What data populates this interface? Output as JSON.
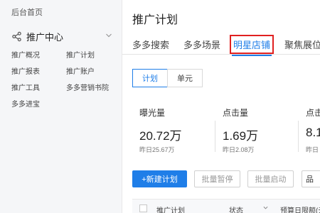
{
  "sidebar": {
    "home": "后台首页",
    "section_title": "推广中心",
    "items": [
      "推广概况",
      "推广计划",
      "推广报表",
      "推广账户",
      "推广工具",
      "多多营销书院",
      "多多进宝"
    ]
  },
  "main": {
    "title": "推广计划",
    "tabs": [
      "多多搜索",
      "多多场景",
      "明星店铺",
      "聚焦展位"
    ],
    "active_tab": "明星店铺",
    "subtabs": [
      "计划",
      "单元"
    ],
    "stats": [
      {
        "label": "曝光量",
        "value": "20.72万",
        "prev": "昨日25.67万"
      },
      {
        "label": "点击量",
        "value": "1.69万",
        "prev": "昨日2.08万"
      },
      {
        "label": "点击量",
        "value": "8.1",
        "prev": "昨日"
      }
    ],
    "buttons": {
      "new_plan": "+新建计划",
      "batch_pause": "批量暂停",
      "batch_start": "批量启动",
      "other": "品"
    },
    "table_headers": [
      "推广计划",
      "状态",
      "预算日限额(元"
    ]
  },
  "colors": {
    "accent": "#1f7ee8",
    "highlight_border": "#e02020",
    "sidebar_bg": "#f5f6f8"
  }
}
